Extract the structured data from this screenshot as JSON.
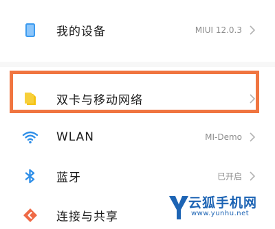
{
  "settings": {
    "items": [
      {
        "label": "我的设备",
        "value": "MIUI 12.0.3",
        "icon": "phone-icon",
        "icon_color": "#3d9bef"
      },
      {
        "label": "双卡与移动网络",
        "value": "",
        "icon": "sim-card-icon",
        "icon_color": "#f5c211"
      },
      {
        "label": "WLAN",
        "value": "MI-Demo",
        "icon": "wifi-icon",
        "icon_color": "#2f8fe8"
      },
      {
        "label": "蓝牙",
        "value": "已开启",
        "icon": "bluetooth-icon",
        "icon_color": "#2f8fe8"
      },
      {
        "label": "连接与共享",
        "value": "",
        "icon": "connection-sharing-icon",
        "icon_color": "#ef6a46"
      }
    ]
  },
  "highlight": {
    "color": "#f07540"
  },
  "watermark": {
    "title": "云狐手机网",
    "url": "www.yunhu.net",
    "logo_letter": "Y",
    "color": "#1d64b4"
  }
}
